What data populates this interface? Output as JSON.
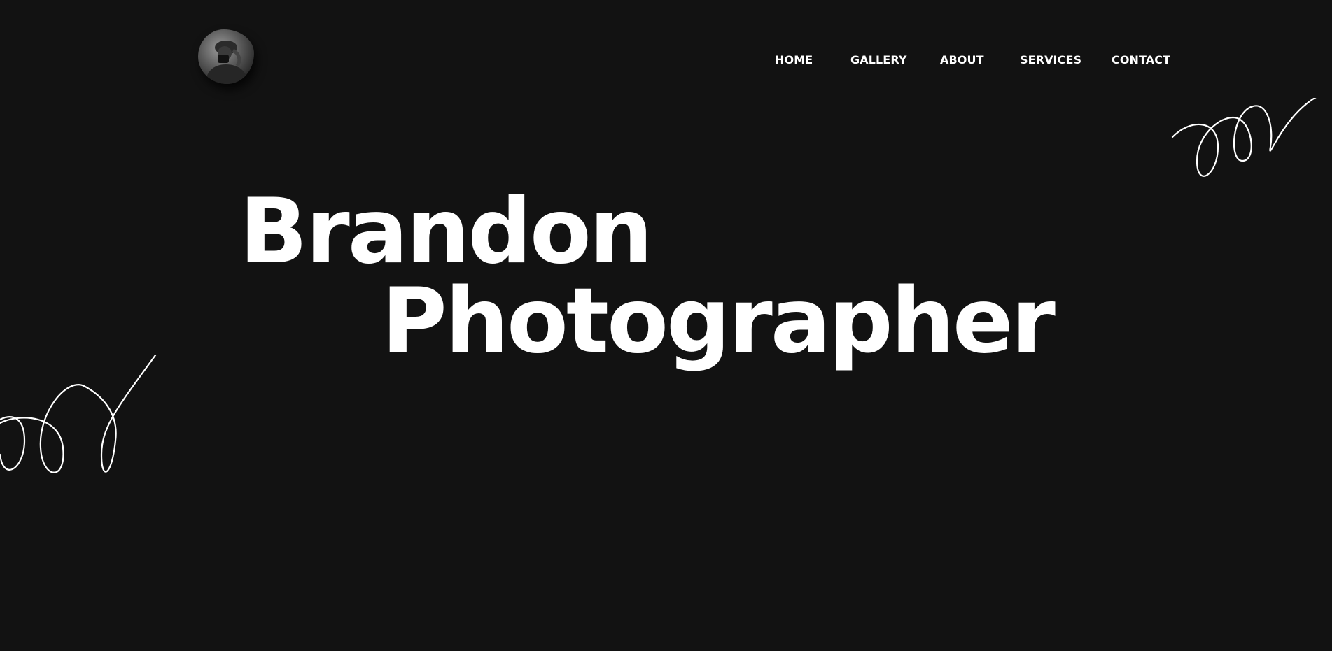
{
  "nav": {
    "items": [
      {
        "label": "HOME"
      },
      {
        "label": "GALLERY"
      },
      {
        "label": "ABOUT"
      },
      {
        "label": "SERVICES"
      },
      {
        "label": "CONTACT"
      }
    ]
  },
  "hero": {
    "line1": "Brandon",
    "line2": "Photographer"
  },
  "colors": {
    "background": "#121212",
    "text": "#ffffff"
  },
  "icons": {
    "avatar": "photographer-avatar",
    "scribble": "scribble-decoration"
  }
}
